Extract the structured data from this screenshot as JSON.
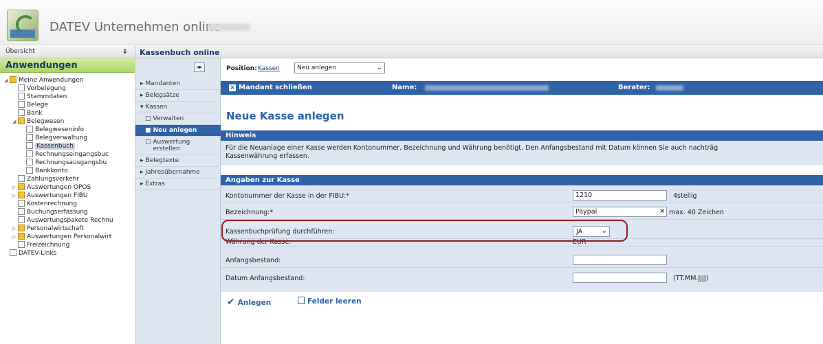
{
  "header": {
    "title": "DATEV Unternehmen online"
  },
  "left": {
    "overview": "Übersicht",
    "pin_icon": "pin-icon",
    "apps_title": "Anwendungen",
    "tree": [
      {
        "label": "Meine Anwendungen",
        "level": 0,
        "folder": true,
        "open": true
      },
      {
        "label": "Vorbelegung",
        "level": 1
      },
      {
        "label": "Stammdaten",
        "level": 1
      },
      {
        "label": "Belege",
        "level": 1
      },
      {
        "label": "Bank",
        "level": 1
      },
      {
        "label": "Belegwesen",
        "level": 1,
        "folder": true,
        "open": true
      },
      {
        "label": "Belegweseninfo",
        "level": 2
      },
      {
        "label": "Belegverwaltung",
        "level": 2
      },
      {
        "label": "Kassenbuch",
        "level": 2,
        "selected": true
      },
      {
        "label": "Rechnungseingangsbuc",
        "level": 2
      },
      {
        "label": "Rechnungsausgangsbu",
        "level": 2
      },
      {
        "label": "Bankkonto",
        "level": 2
      },
      {
        "label": "Zahlungsverkehr",
        "level": 1
      },
      {
        "label": "Auswertungen OPOS",
        "level": 1,
        "folder": true
      },
      {
        "label": "Auswertungen FIBU",
        "level": 1,
        "folder": true
      },
      {
        "label": "Kostenrechnung",
        "level": 1
      },
      {
        "label": "Buchungserfassung",
        "level": 1
      },
      {
        "label": "Auswertungspakete Rechnu",
        "level": 1
      },
      {
        "label": "Personalwirtschaft",
        "level": 1,
        "folder": true
      },
      {
        "label": "Auswertungen Personalwirt",
        "level": 1,
        "folder": true
      },
      {
        "label": "Freizeichnung",
        "level": 1
      },
      {
        "label": "DATEV-Links",
        "level": 0
      }
    ]
  },
  "kassenbuch": {
    "title": "Kassenbuch online",
    "nav": [
      {
        "label": "▸ Mandanten",
        "sub": false,
        "active": false
      },
      {
        "label": "▸ Belegsätze",
        "sub": false,
        "active": false
      },
      {
        "label": "▾ Kassen",
        "sub": false,
        "active": false
      },
      {
        "label": "□ Verwalten",
        "sub": true,
        "active": false
      },
      {
        "label": "■ Neu anlegen",
        "sub": true,
        "active": true
      },
      {
        "label": "□ Auswertung\n    erstellen",
        "sub": true,
        "active": false
      },
      {
        "label": "▸ Belegtexte",
        "sub": false,
        "active": false
      },
      {
        "label": "▸ Jahresübernahme",
        "sub": false,
        "active": false
      },
      {
        "label": "▸ Extras",
        "sub": false,
        "active": false
      }
    ]
  },
  "position": {
    "label": "Position:",
    "link": "Kassen",
    "select_value": "Neu anlegen"
  },
  "mandant": {
    "close_label": "Mandant schließen",
    "name_label": "Name:",
    "berater_label": "Berater:"
  },
  "page_title": "Neue Kasse anlegen",
  "hinweis": {
    "head": "Hinweis",
    "text": "Für die Neuanlage einer Kasse werden Kontonummer, Bezeichnung und Währung benötigt. Den Anfangsbestand mit Datum können Sie auch nachträg",
    "text2": "Kassenwährung erfassen."
  },
  "form": {
    "head": "Angaben zur Kasse",
    "konto_label": "Kontonummer der Kasse in der FIBU:*",
    "konto_value": "1210",
    "konto_hint": "4stellig",
    "bez_label": "Bezeichnung:*",
    "bez_value": "Paypal",
    "bez_hint": "max. 40 Zeichen",
    "pruefung_label": "Kassenbuchprüfung durchführen:",
    "pruefung_value": "JA",
    "waehrung_label": "Währung der Kasse:",
    "waehrung_value": "EUR",
    "anfang_label": "Anfangsbestand:",
    "datum_label": "Datum Anfangsbestand:",
    "datum_hint": "(TT.MM.JJJJ)"
  },
  "actions": {
    "create": "Anlegen",
    "clear": "Felder leeren"
  },
  "colors": {
    "accent": "#2f62a6",
    "panel": "#dde6f1",
    "green": "#a9d466",
    "highlight": "#9b1c1c"
  }
}
